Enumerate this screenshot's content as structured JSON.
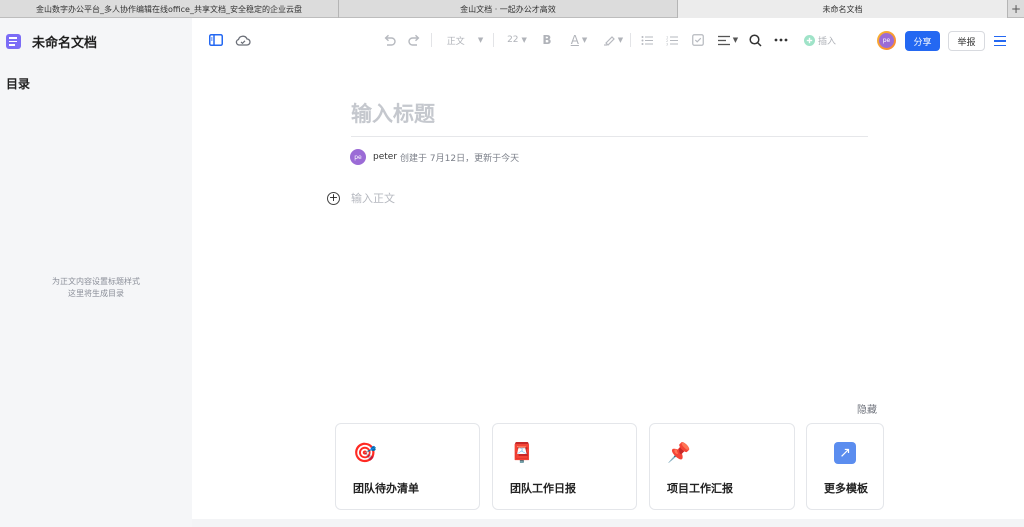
{
  "browser_tabs": [
    "金山数字办公平台_多人协作编辑在线office_共享文档_安全稳定的企业云盘",
    "金山文档 · 一起办公才高效",
    "未命名文档"
  ],
  "browser_new_tab_label": "+",
  "sidebar": {
    "doc_title": "未命名文档",
    "toc_title": "目录",
    "toc_empty_line1": "为正文内容设置标题样式",
    "toc_empty_line2": "这里将生成目录"
  },
  "toolbar": {
    "style_label": "正文",
    "font_size": "22",
    "bold_label": "B",
    "font_color_label": "A",
    "insert_label": "插入",
    "avatar_initials": "pe",
    "share_label": "分享",
    "report_label": "举报"
  },
  "document": {
    "title_placeholder": "输入标题",
    "author_initials": "pe",
    "author": "peter",
    "meta_text": "创建于 7月12日，更新于今天",
    "body_placeholder": "输入正文"
  },
  "templates": {
    "hide_label": "隐藏",
    "cards": [
      {
        "label": "团队待办清单",
        "icon": "direct-hit-icon",
        "glyph": "🎯"
      },
      {
        "label": "团队工作日报",
        "icon": "postbox-icon",
        "glyph": "📮"
      },
      {
        "label": "项目工作汇报",
        "icon": "pushpin-icon",
        "glyph": "📌"
      },
      {
        "label": "更多模板",
        "icon": "arrow-up-right-icon",
        "glyph": "↗"
      }
    ]
  },
  "colors": {
    "accent": "#2468f2",
    "doc_icon": "#7b6cf6",
    "avatar": "#9b6bd6"
  }
}
